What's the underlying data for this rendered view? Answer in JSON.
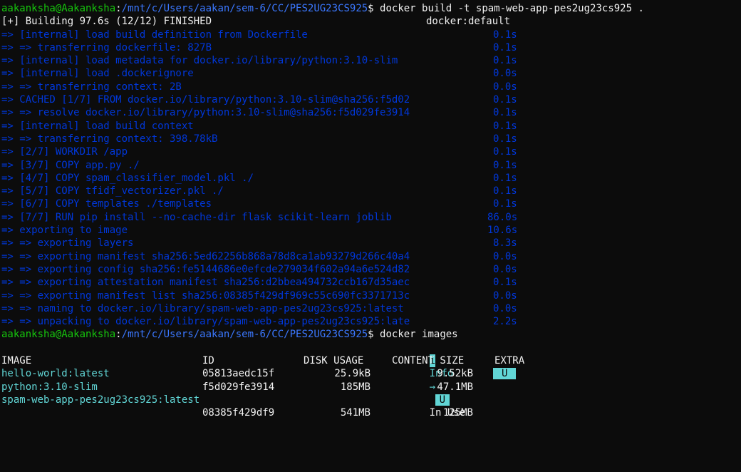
{
  "prompt": {
    "user_host": "aakanksha@Aakanksha",
    "sep": ":",
    "path": "/mnt/c/Users/aakan/sem-6/CC/PES2UG23CS925",
    "dollar": "$"
  },
  "commands": {
    "build": " docker build -t spam-web-app-pes2ug23cs925 .",
    "images": " docker images"
  },
  "build_header": {
    "text": "[+] Building 97.6s (12/12) FINISHED",
    "context": "docker:default"
  },
  "steps": [
    {
      "text": "=> [internal] load build definition from Dockerfile",
      "time": "0.1s"
    },
    {
      "text": "=> => transferring dockerfile: 827B",
      "time": "0.1s"
    },
    {
      "text": "=> [internal] load metadata for docker.io/library/python:3.10-slim",
      "time": "0.1s"
    },
    {
      "text": "=> [internal] load .dockerignore",
      "time": "0.0s"
    },
    {
      "text": "=> => transferring context: 2B",
      "time": "0.0s"
    },
    {
      "text": "=> CACHED [1/7] FROM docker.io/library/python:3.10-slim@sha256:f5d02",
      "time": "0.1s"
    },
    {
      "text": "=> => resolve docker.io/library/python:3.10-slim@sha256:f5d029fe3914",
      "time": "0.1s"
    },
    {
      "text": "=> [internal] load build context",
      "time": "0.1s"
    },
    {
      "text": "=> => transferring context: 398.78kB",
      "time": "0.1s"
    },
    {
      "text": "=> [2/7] WORKDIR /app",
      "time": "0.1s"
    },
    {
      "text": "=> [3/7] COPY app.py ./",
      "time": "0.1s"
    },
    {
      "text": "=> [4/7] COPY spam_classifier_model.pkl ./",
      "time": "0.1s"
    },
    {
      "text": "=> [5/7] COPY tfidf_vectorizer.pkl ./",
      "time": "0.1s"
    },
    {
      "text": "=> [6/7] COPY templates ./templates",
      "time": "0.1s"
    },
    {
      "text": "=> [7/7] RUN pip install --no-cache-dir flask scikit-learn joblib",
      "time": "86.0s"
    },
    {
      "text": "=> exporting to image",
      "time": "10.6s"
    },
    {
      "text": "=> => exporting layers",
      "time": "8.3s"
    },
    {
      "text": "=> => exporting manifest sha256:5ed62256b868a78d8ca1ab93279d266c40a4",
      "time": "0.0s"
    },
    {
      "text": "=> => exporting config sha256:fe5144686e0efcde279034f602a94a6e524d82",
      "time": "0.0s"
    },
    {
      "text": "=> => exporting attestation manifest sha256:d2bbea494732ccb167d35aec",
      "time": "0.1s"
    },
    {
      "text": "=> => exporting manifest list sha256:08385f429df969c55c690fc3371713c",
      "time": "0.0s"
    },
    {
      "text": "=> => naming to docker.io/library/spam-web-app-pes2ug23cs925:latest",
      "time": "0.0s"
    },
    {
      "text": "=> => unpacking to docker.io/library/spam-web-app-pes2ug23cs925:late",
      "time": "2.2s"
    }
  ],
  "legend": {
    "info_icon": "i",
    "info_label": "Info",
    "arrow": "→",
    "u_badge": "U",
    "in_use": "In Use"
  },
  "images_table": {
    "headers": {
      "image": "IMAGE",
      "id": "ID",
      "disk_usage": "DISK USAGE",
      "content_size": "CONTENT SIZE",
      "extra": "EXTRA"
    },
    "rows": [
      {
        "image": "hello-world:latest",
        "id": "05813aedc15f",
        "disk_usage": "25.9kB",
        "content_size": "9.52kB",
        "extra": "U"
      },
      {
        "image": "python:3.10-slim",
        "id": "f5d029fe3914",
        "disk_usage": "185MB",
        "content_size": "47.1MB",
        "extra": ""
      },
      {
        "image": "spam-web-app-pes2ug23cs925:latest",
        "id": "08385f429df9",
        "disk_usage": "541MB",
        "content_size": "125MB",
        "extra": ""
      }
    ]
  },
  "colors": {
    "background": "#0c0c0c",
    "prompt_user": "#16c60c",
    "prompt_path": "#3b78ff",
    "build_steps": "#0037da",
    "image_name": "#61d6d6",
    "badge": "#61d6d6"
  }
}
